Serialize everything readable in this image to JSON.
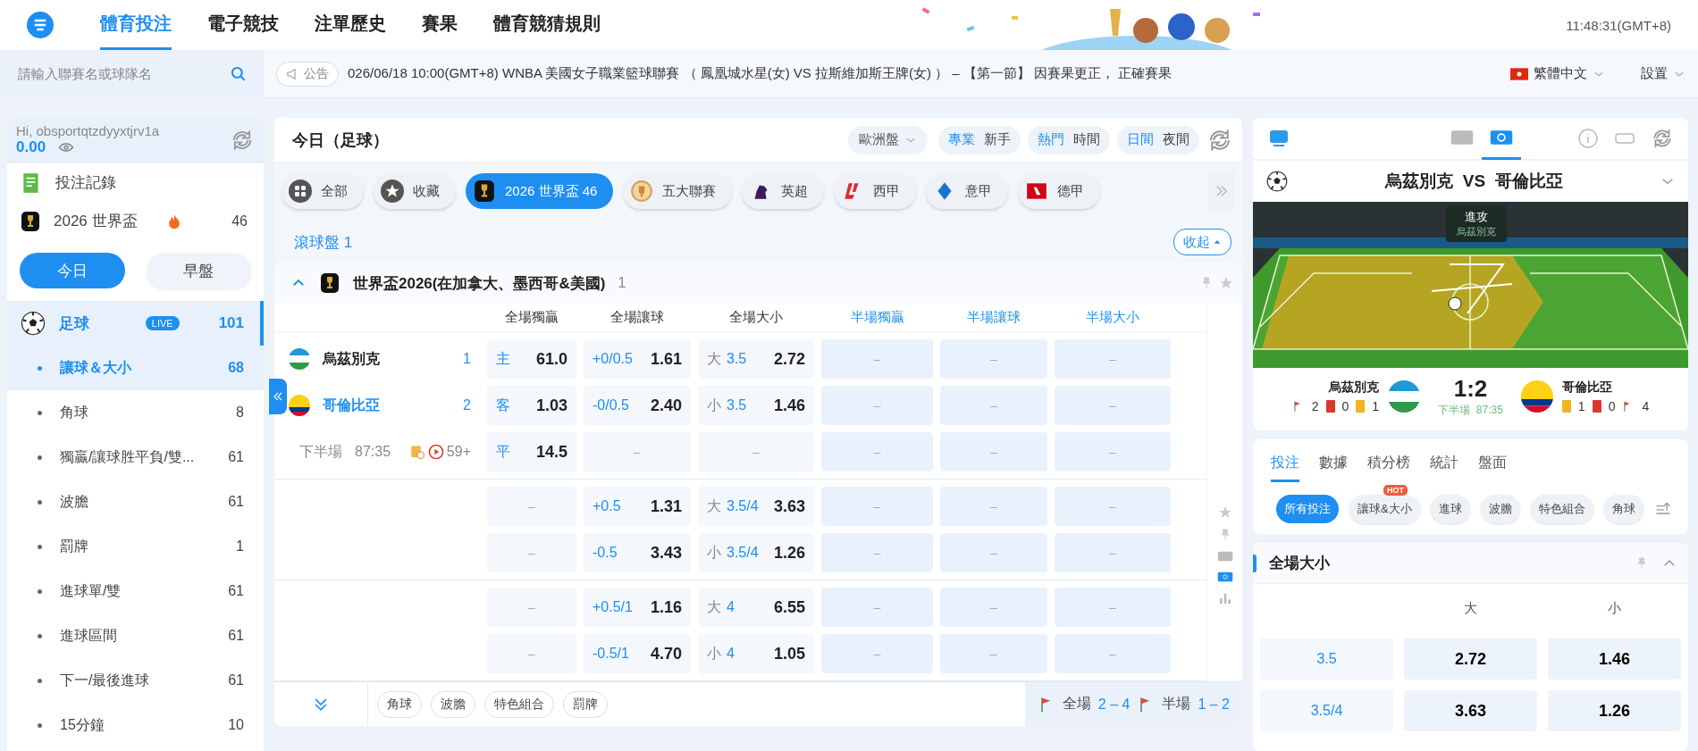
{
  "header": {
    "nav": [
      {
        "label": "體育投注",
        "selected": true
      },
      {
        "label": "電子競技",
        "selected": false
      },
      {
        "label": "注單歷史",
        "selected": false
      },
      {
        "label": "賽果",
        "selected": false
      },
      {
        "label": "體育競猜規則",
        "selected": false
      }
    ],
    "time": "11:48:31(GMT+8)"
  },
  "search": {
    "placeholder": "請輸入聯賽名或球隊名"
  },
  "announcement": {
    "label": "公告",
    "text": "026/06/18 10:00(GMT+8) WNBA 美國女子職業籃球聯賽 （ 鳳凰城水星(女) VS 拉斯維加斯王牌(女) ） – 【第一節】 因賽果更正， 正確賽果"
  },
  "language": "繁體中文",
  "settings": "設置",
  "account": {
    "greeting": "Hi, obsportqtzdyyxtjrv1a",
    "balance": "0.00"
  },
  "shortcuts": [
    {
      "kind": "records",
      "label": "投注記錄"
    },
    {
      "kind": "worldcup",
      "label": "2026 世界盃",
      "count": "46",
      "hot": true
    }
  ],
  "period_tabs": [
    {
      "label": "今日",
      "selected": true
    },
    {
      "label": "早盤",
      "selected": false
    }
  ],
  "sport": {
    "name": "足球",
    "badge": "LIVE",
    "count": "101"
  },
  "markets": [
    {
      "label": "讓球＆大小",
      "count": "68",
      "selected": true
    },
    {
      "label": "角球",
      "count": "8",
      "selected": false
    },
    {
      "label": "獨贏/讓球胜平負/雙...",
      "count": "61",
      "selected": false
    },
    {
      "label": "波膽",
      "count": "61",
      "selected": false
    },
    {
      "label": "罰牌",
      "count": "1",
      "selected": false
    },
    {
      "label": "進球單/雙",
      "count": "61",
      "selected": false
    },
    {
      "label": "進球區間",
      "count": "61",
      "selected": false
    },
    {
      "label": "下一/最後進球",
      "count": "61",
      "selected": false
    },
    {
      "label": "15分鐘",
      "count": "10",
      "selected": false
    }
  ],
  "main": {
    "title": "今日（足球）",
    "odds_type": "歐洲盤",
    "toggles": [
      [
        {
          "label": "專業",
          "selected": true
        },
        {
          "label": "新手",
          "selected": false
        }
      ],
      [
        {
          "label": "熱門",
          "selected": true
        },
        {
          "label": "時間",
          "selected": false
        }
      ],
      [
        {
          "label": "日間",
          "selected": true
        },
        {
          "label": "夜間",
          "selected": false
        }
      ]
    ],
    "league_tabs": [
      {
        "kind": "all",
        "label": "全部",
        "selected": false
      },
      {
        "kind": "favorites",
        "label": "收藏",
        "selected": false
      },
      {
        "kind": "worldcup",
        "label": "2026 世界盃 46",
        "selected": true
      },
      {
        "kind": "top5",
        "label": "五大聯賽",
        "selected": false
      },
      {
        "kind": "epl",
        "label": "英超",
        "selected": false
      },
      {
        "kind": "laliga",
        "label": "西甲",
        "selected": false
      },
      {
        "kind": "seriea",
        "label": "意甲",
        "selected": false
      },
      {
        "kind": "bundesliga",
        "label": "德甲",
        "selected": false
      }
    ],
    "live_section": {
      "label": "滾球盤 1",
      "collapse": "收起"
    },
    "league": {
      "name": "世界盃2026(在加拿大、墨西哥&美國)",
      "count": "1"
    },
    "columns": [
      {
        "label": "全場獨贏",
        "half": false
      },
      {
        "label": "全場讓球",
        "half": false
      },
      {
        "label": "全場大小",
        "half": false
      },
      {
        "label": "半場獨贏",
        "half": true
      },
      {
        "label": "半場讓球",
        "half": true
      },
      {
        "label": "半場大小",
        "half": true
      }
    ],
    "match": {
      "teams": [
        {
          "kind": "uzbekistan",
          "name": "烏茲別克",
          "score": "1",
          "leading": false
        },
        {
          "kind": "colombia",
          "name": "哥倫比亞",
          "score": "2",
          "leading": true
        }
      ],
      "period": "下半場",
      "clock": "87:35",
      "more": "59+"
    },
    "groups": [
      [
        [
          {
            "kind": "result",
            "prefix": "主",
            "odds": "61.0"
          },
          {
            "kind": "handicap",
            "line": "+0/0.5",
            "odds": "1.61"
          },
          {
            "kind": "total",
            "prefix": "大",
            "line": "3.5",
            "odds": "2.72"
          },
          {
            "kind": "empty",
            "dash": "–"
          },
          {
            "kind": "empty",
            "dash": "–"
          },
          {
            "kind": "empty",
            "dash": "–"
          }
        ],
        [
          {
            "kind": "result",
            "prefix": "客",
            "odds": "1.03"
          },
          {
            "kind": "handicap",
            "line": "-0/0.5",
            "odds": "2.40"
          },
          {
            "kind": "total",
            "prefix": "小",
            "line": "3.5",
            "odds": "1.46"
          },
          {
            "kind": "empty",
            "dash": "–"
          },
          {
            "kind": "empty",
            "dash": "–"
          },
          {
            "kind": "empty",
            "dash": "–"
          }
        ],
        [
          {
            "kind": "result",
            "prefix": "平",
            "odds": "14.5"
          },
          {
            "kind": "empty",
            "dash": "–"
          },
          {
            "kind": "empty",
            "dash": "–"
          },
          {
            "kind": "empty",
            "dash": "–"
          },
          {
            "kind": "empty",
            "dash": "–"
          },
          {
            "kind": "empty",
            "dash": "–"
          }
        ]
      ],
      [
        [
          {
            "kind": "empty",
            "dash": "–"
          },
          {
            "kind": "handicap",
            "line": "+0.5",
            "odds": "1.31"
          },
          {
            "kind": "total",
            "prefix": "大",
            "line": "3.5/4",
            "odds": "3.63"
          },
          {
            "kind": "empty",
            "dash": "–"
          },
          {
            "kind": "empty",
            "dash": "–"
          },
          {
            "kind": "empty",
            "dash": "–"
          }
        ],
        [
          {
            "kind": "empty",
            "dash": "–"
          },
          {
            "kind": "handicap",
            "line": "-0.5",
            "odds": "3.43"
          },
          {
            "kind": "total",
            "prefix": "小",
            "line": "3.5/4",
            "odds": "1.26"
          },
          {
            "kind": "empty",
            "dash": "–"
          },
          {
            "kind": "empty",
            "dash": "–"
          },
          {
            "kind": "empty",
            "dash": "–"
          }
        ]
      ],
      [
        [
          {
            "kind": "empty",
            "dash": "–"
          },
          {
            "kind": "handicap",
            "line": "+0.5/1",
            "odds": "1.16"
          },
          {
            "kind": "total",
            "prefix": "大",
            "line": "4",
            "odds": "6.55"
          },
          {
            "kind": "empty",
            "dash": "–"
          },
          {
            "kind": "empty",
            "dash": "–"
          },
          {
            "kind": "empty",
            "dash": "–"
          }
        ],
        [
          {
            "kind": "empty",
            "dash": "–"
          },
          {
            "kind": "handicap",
            "line": "-0.5/1",
            "odds": "4.70"
          },
          {
            "kind": "total",
            "prefix": "小",
            "line": "4",
            "odds": "1.05"
          },
          {
            "kind": "empty",
            "dash": "–"
          },
          {
            "kind": "empty",
            "dash": "–"
          },
          {
            "kind": "empty",
            "dash": "–"
          }
        ]
      ]
    ],
    "extra_tags": [
      "角球",
      "波膽",
      "特色組合",
      "罰牌"
    ],
    "corners": [
      {
        "label": "全場",
        "value": "2 – 4"
      },
      {
        "label": "半場",
        "value": "1 – 2"
      }
    ]
  },
  "tracker": {
    "view_tabs": [
      {
        "kind": "scoreboard",
        "selected": false
      },
      {
        "kind": "pitch",
        "selected": true
      }
    ],
    "title": "烏茲別克  VS  哥倫比亞",
    "event": "進攻",
    "event_team": "烏茲別克",
    "score": "1:2",
    "period": "下半場",
    "clock": "87:35",
    "teams": [
      {
        "kind": "uzbekistan",
        "name": "烏茲別克",
        "stats": [
          {
            "kind": "corners",
            "value": "2"
          },
          {
            "kind": "red",
            "value": "0"
          },
          {
            "kind": "yellow",
            "value": "1"
          }
        ]
      },
      {
        "kind": "colombia",
        "name": "哥倫比亞",
        "stats": [
          {
            "kind": "yellow",
            "value": "1"
          },
          {
            "kind": "red",
            "value": "0"
          },
          {
            "kind": "corners",
            "value": "4"
          }
        ]
      }
    ],
    "tabs": [
      {
        "label": "投注",
        "selected": true
      },
      {
        "label": "數據",
        "selected": false
      },
      {
        "label": "積分榜",
        "selected": false
      },
      {
        "label": "統計",
        "selected": false
      },
      {
        "label": "盤面",
        "selected": false
      }
    ],
    "chips": [
      {
        "label": "所有投注",
        "selected": true
      },
      {
        "label": "讓球&大小",
        "selected": false,
        "badge": "HOT"
      },
      {
        "label": "進球",
        "selected": false
      },
      {
        "label": "波膽",
        "selected": false
      },
      {
        "label": "特色組合",
        "selected": false
      },
      {
        "label": "角球",
        "selected": false
      }
    ],
    "market": {
      "title": "全場大小",
      "columns": [
        "大",
        "小"
      ],
      "rows": [
        {
          "line": "3.5",
          "over": "2.72",
          "under": "1.46"
        },
        {
          "line": "3.5/4",
          "over": "3.63",
          "under": "1.26"
        }
      ]
    }
  }
}
